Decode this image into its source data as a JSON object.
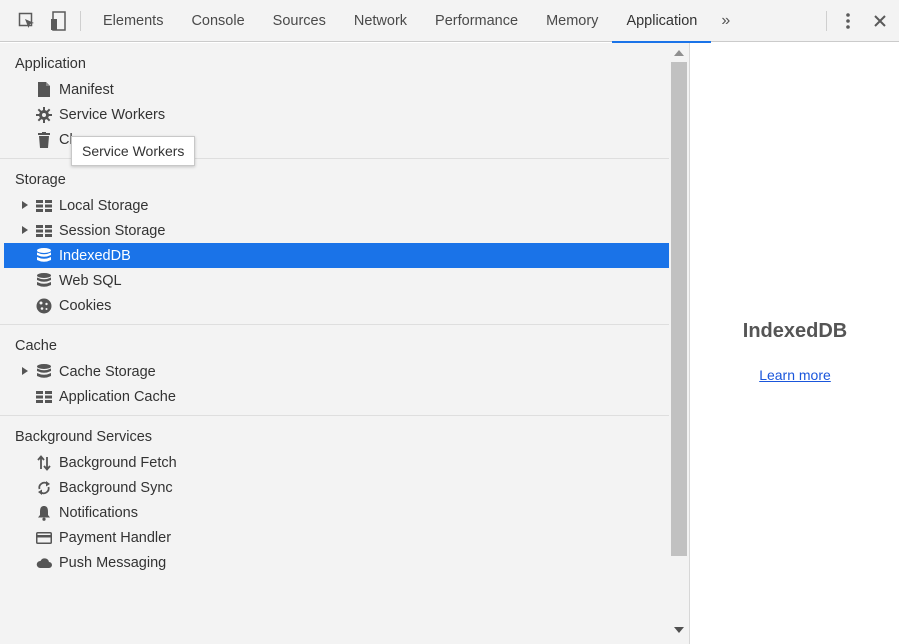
{
  "toolbar": {
    "tabs": [
      "Elements",
      "Console",
      "Sources",
      "Network",
      "Performance",
      "Memory",
      "Application"
    ],
    "active_tab": "Application",
    "more_tabs": "»"
  },
  "sidebar": {
    "sections": [
      {
        "title": "Application",
        "items": [
          {
            "label": "Manifest",
            "icon": "document-icon"
          },
          {
            "label": "Service Workers",
            "icon": "gear-icon"
          },
          {
            "label": "Cl",
            "icon": "trash-icon"
          }
        ]
      },
      {
        "title": "Storage",
        "items": [
          {
            "label": "Local Storage",
            "icon": "grid-icon",
            "expandable": true
          },
          {
            "label": "Session Storage",
            "icon": "grid-icon",
            "expandable": true
          },
          {
            "label": "IndexedDB",
            "icon": "database-icon",
            "selected": true
          },
          {
            "label": "Web SQL",
            "icon": "database-icon"
          },
          {
            "label": "Cookies",
            "icon": "cookie-icon"
          }
        ]
      },
      {
        "title": "Cache",
        "items": [
          {
            "label": "Cache Storage",
            "icon": "database-icon",
            "expandable": true
          },
          {
            "label": "Application Cache",
            "icon": "grid-icon"
          }
        ]
      },
      {
        "title": "Background Services",
        "items": [
          {
            "label": "Background Fetch",
            "icon": "arrows-updown-icon"
          },
          {
            "label": "Background Sync",
            "icon": "sync-icon"
          },
          {
            "label": "Notifications",
            "icon": "bell-icon"
          },
          {
            "label": "Payment Handler",
            "icon": "card-icon"
          },
          {
            "label": "Push Messaging",
            "icon": "cloud-icon"
          }
        ]
      }
    ]
  },
  "tooltip": {
    "text": "Service Workers"
  },
  "main": {
    "title": "IndexedDB",
    "link": "Learn more"
  },
  "colors": {
    "accent": "#1a73e8",
    "sidebar_bg": "#f3f3f3",
    "link": "#1a56db"
  }
}
